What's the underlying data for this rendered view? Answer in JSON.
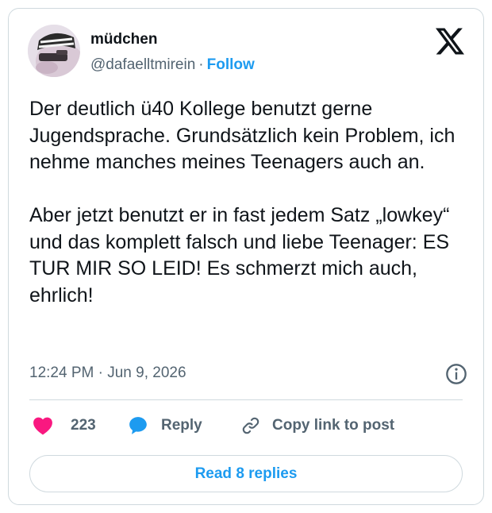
{
  "tweet": {
    "author_name": "müdchen",
    "author_handle": "@dafaelltmirein",
    "separator": "·",
    "follow_label": "Follow",
    "text": "Der deutlich ü40 Kollege benutzt gerne Jugendsprache. Grundsätzlich kein Problem, ich nehme manches meines Teenagers auch an.\n\nAber jetzt benutzt er in fast jedem Satz „lowkey“ und das komplett falsch und liebe Teenager: ES TUR MIR SO LEID! Es schmerzt mich auch, ehrlich!",
    "timestamp": "12:24 PM · Jun 9, 2026"
  },
  "actions": {
    "like_count": "223",
    "reply_label": "Reply",
    "copy_label": "Copy link to post"
  },
  "footer": {
    "read_replies_label": "Read 8 replies"
  },
  "colors": {
    "accent": "#1d9bf0",
    "like": "#f91880",
    "secondary_text": "#536471",
    "border": "#cfd9de"
  },
  "icons": [
    "x-logo-icon",
    "info-icon",
    "heart-icon",
    "reply-bubble-icon",
    "link-icon"
  ]
}
